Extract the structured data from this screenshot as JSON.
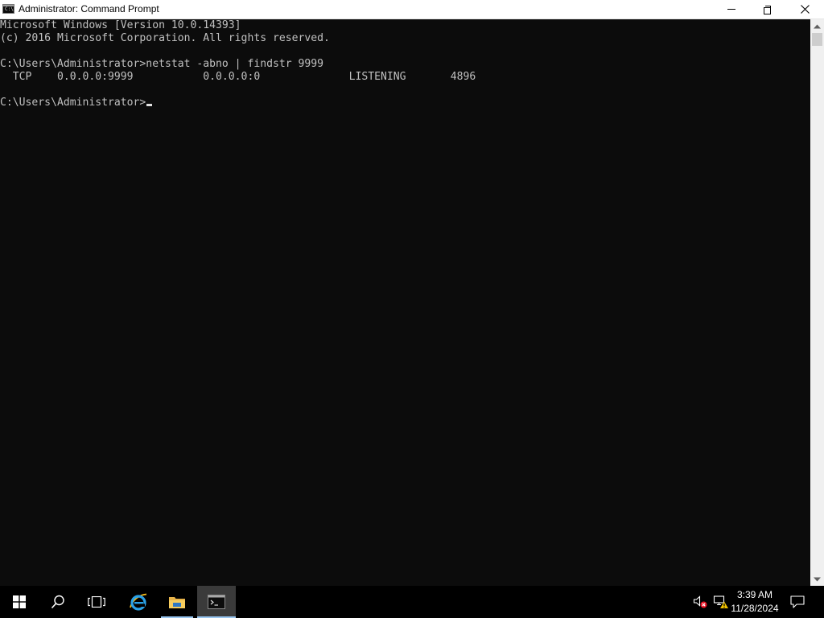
{
  "window": {
    "title": "Administrator: Command Prompt",
    "icon_label": "C:\\"
  },
  "console": {
    "lines": [
      "Microsoft Windows [Version 10.0.14393]",
      "(c) 2016 Microsoft Corporation. All rights reserved.",
      "",
      "C:\\Users\\Administrator>netstat -abno | findstr 9999",
      "  TCP    0.0.0.0:9999           0.0.0.0:0              LISTENING       4896",
      "",
      "C:\\Users\\Administrator>"
    ]
  },
  "taskbar": {
    "items": [
      "start-icon",
      "search-icon",
      "task-view-icon",
      "internet-explorer-icon",
      "file-explorer-icon",
      "command-prompt-icon"
    ],
    "clock_time": "3:39 AM",
    "clock_date": "11/28/2024",
    "tray_icons": [
      "volume-muted-icon",
      "network-warning-icon",
      "action-center-icon"
    ]
  },
  "colors": {
    "console_bg": "#0c0c0c",
    "console_text": "#c0c0c0",
    "taskbar_bg": "#000000",
    "active_indicator": "#99c6f0"
  }
}
